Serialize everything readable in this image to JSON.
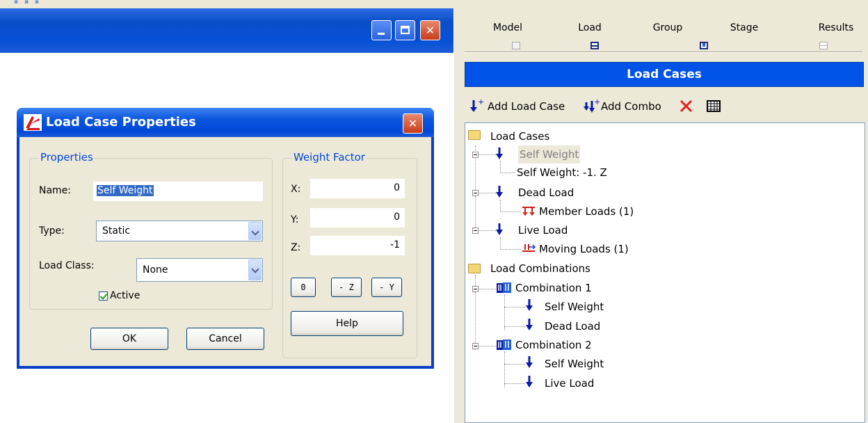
{
  "top_tabs": [
    {
      "label": "Model"
    },
    {
      "label": "Load"
    },
    {
      "label": "Group"
    },
    {
      "label": "Stage"
    },
    {
      "label": "Results"
    }
  ],
  "panel_header": "Load Cases",
  "toolbar": {
    "add_load_case": "Add Load Case",
    "add_combo": "Add Combo"
  },
  "tree": {
    "load_cases_folder": "Load Cases",
    "self_weight": "Self Weight",
    "self_weight_detail": "Self Weight: -1. Z",
    "dead_load": "Dead Load",
    "member_loads": "Member Loads (1)",
    "live_load": "Live Load",
    "moving_loads": "Moving Loads (1)",
    "load_combinations_folder": "Load Combinations",
    "combination_1": "Combination 1",
    "c1_item1": "Self Weight",
    "c1_item2": "Dead Load",
    "combination_2": "Combination 2",
    "c2_item1": "Self Weight",
    "c2_item2": "Live Load"
  },
  "dialog": {
    "title": "Load Case Properties",
    "properties_group": "Properties",
    "name_label": "Name:",
    "name_value": "Self Weight",
    "type_label": "Type:",
    "type_value": "Static",
    "load_class_label": "Load Class:",
    "load_class_value": "None",
    "active_label": "Active",
    "active_checked": true,
    "weight_factor_group": "Weight Factor",
    "x_label": "X:",
    "x_value": "0",
    "y_label": "Y:",
    "y_value": "0",
    "z_label": "Z:",
    "z_value": "-1",
    "btn_zero": "0",
    "btn_minus_z": "- Z",
    "btn_minus_y": "- Y",
    "help_label": "Help",
    "ok_label": "OK",
    "cancel_label": "Cancel"
  },
  "colors": {
    "xp_title_blue": "#0a55dd",
    "header_blue": "#0053e6",
    "group_label_blue": "#0046d5",
    "window_bg": "#ece9d8"
  }
}
